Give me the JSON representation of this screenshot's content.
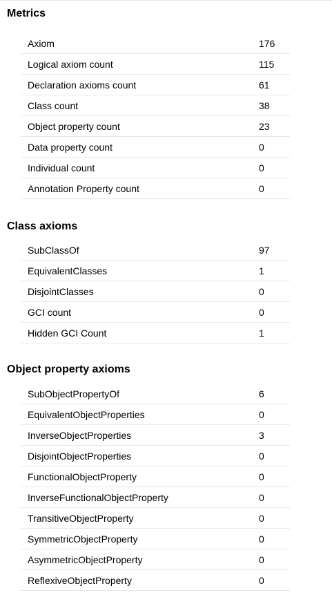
{
  "sections": [
    {
      "title": "Metrics",
      "rows": [
        {
          "label": "Axiom",
          "value": "176"
        },
        {
          "label": "Logical axiom count",
          "value": "115"
        },
        {
          "label": "Declaration axioms count",
          "value": "61"
        },
        {
          "label": "Class count",
          "value": "38"
        },
        {
          "label": "Object property count",
          "value": "23"
        },
        {
          "label": "Data property count",
          "value": "0"
        },
        {
          "label": "Individual count",
          "value": "0"
        },
        {
          "label": "Annotation Property count",
          "value": "0"
        }
      ]
    },
    {
      "title": "Class axioms",
      "rows": [
        {
          "label": "SubClassOf",
          "value": "97"
        },
        {
          "label": "EquivalentClasses",
          "value": "1"
        },
        {
          "label": "DisjointClasses",
          "value": "0"
        },
        {
          "label": "GCI count",
          "value": "0"
        },
        {
          "label": "Hidden GCI Count",
          "value": "1"
        }
      ]
    },
    {
      "title": "Object property axioms",
      "rows": [
        {
          "label": "SubObjectPropertyOf",
          "value": "6"
        },
        {
          "label": "EquivalentObjectProperties",
          "value": "0"
        },
        {
          "label": "InverseObjectProperties",
          "value": "3"
        },
        {
          "label": "DisjointObjectProperties",
          "value": "0"
        },
        {
          "label": "FunctionalObjectProperty",
          "value": "0"
        },
        {
          "label": "InverseFunctionalObjectProperty",
          "value": "0"
        },
        {
          "label": "TransitiveObjectProperty",
          "value": "0"
        },
        {
          "label": "SymmetricObjectProperty",
          "value": "0"
        },
        {
          "label": "AsymmetricObjectProperty",
          "value": "0"
        },
        {
          "label": "ReflexiveObjectProperty",
          "value": "0"
        }
      ]
    }
  ]
}
